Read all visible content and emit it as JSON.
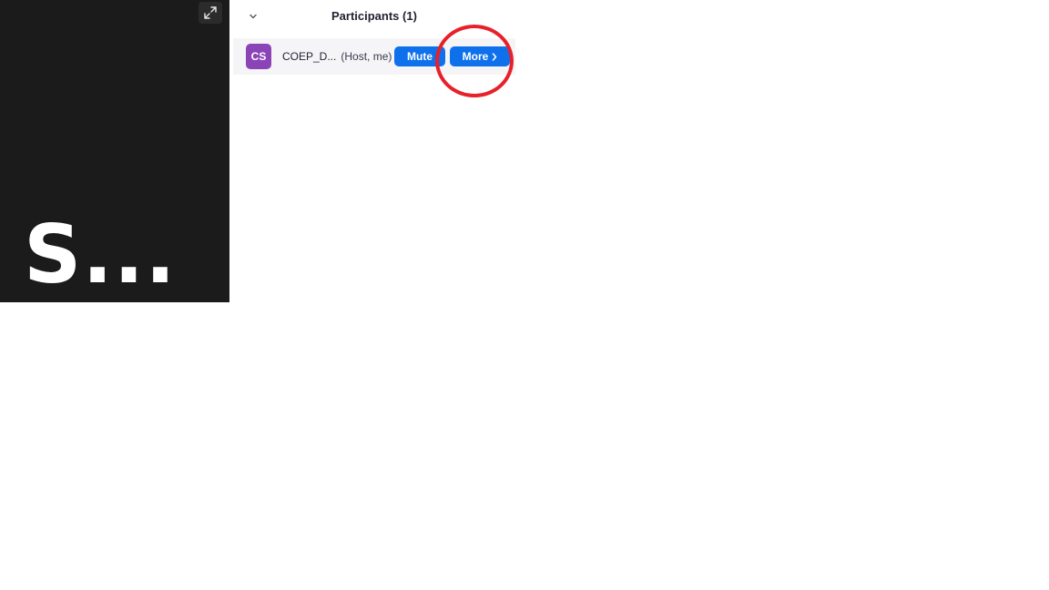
{
  "video": {
    "display_name": "S...",
    "expand_icon": "expand-icon"
  },
  "participants_panel": {
    "title": "Participants (1)",
    "collapse_icon": "chevron-down-icon",
    "participants": [
      {
        "avatar_initials": "CS",
        "avatar_color": "#8a44b8",
        "name": "COEP_D...",
        "role": "(Host, me)",
        "mute_label": "Mute",
        "more_label": "More"
      }
    ]
  },
  "colors": {
    "button_blue": "#0e71eb",
    "annotation_red": "#e8202a",
    "video_bg": "#1b1b1b"
  }
}
